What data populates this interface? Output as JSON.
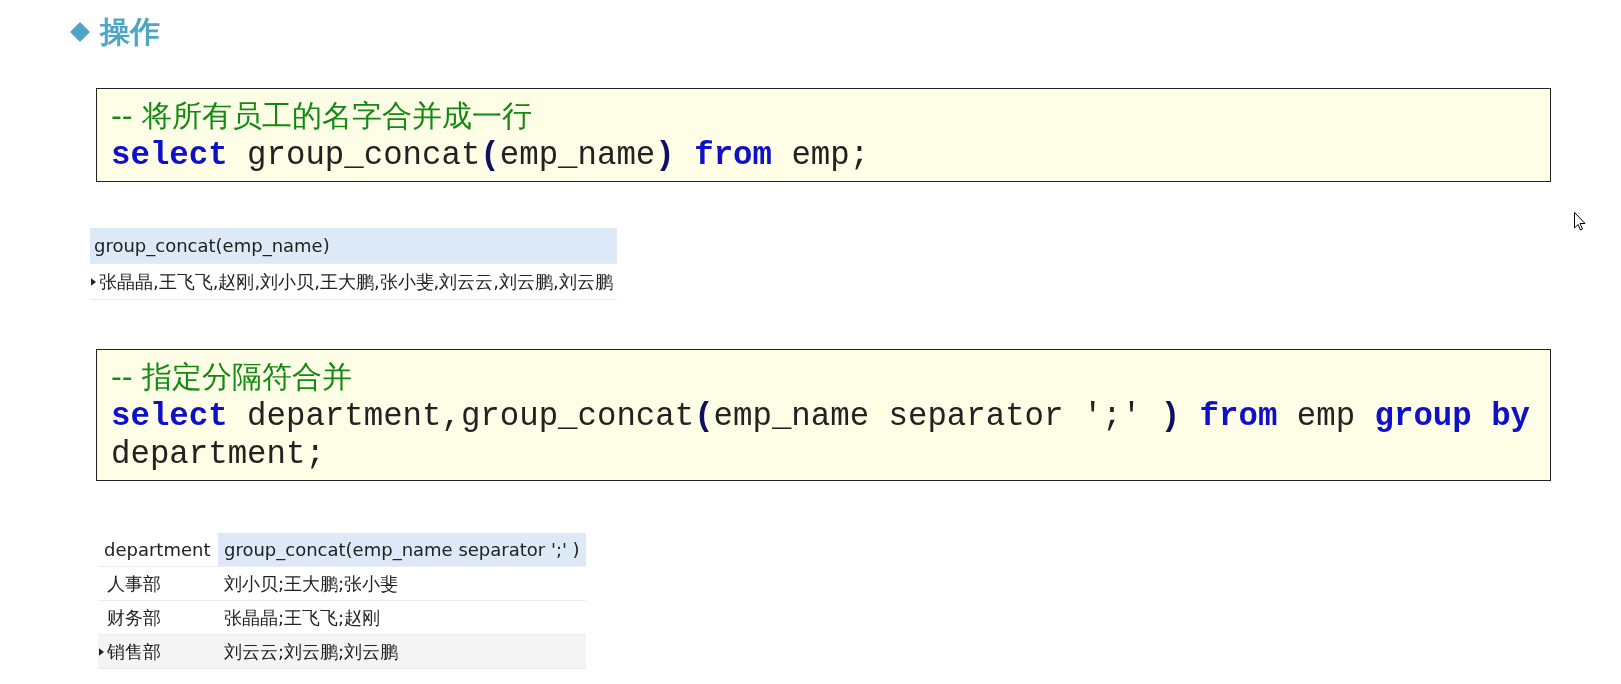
{
  "heading": {
    "title": "操作"
  },
  "sections": [
    {
      "code": [
        [
          {
            "kind": "comment",
            "text": "-- 将所有员工的名字合并成一行"
          }
        ],
        [
          {
            "kind": "keyword",
            "text": "select"
          },
          {
            "kind": "plain",
            "text": " group_concat"
          },
          {
            "kind": "punct",
            "text": "("
          },
          {
            "kind": "plain",
            "text": "emp_name"
          },
          {
            "kind": "punct",
            "text": ")"
          },
          {
            "kind": "keyword",
            "text": " from"
          },
          {
            "kind": "plain",
            "text": " emp;"
          }
        ]
      ],
      "result": {
        "columns": [
          "group_concat(emp_name)"
        ],
        "rows": [
          {
            "selected": true,
            "cells": [
              "张晶晶,王飞飞,赵刚,刘小贝,王大鹏,张小斐,刘云云,刘云鹏,刘云鹏"
            ]
          }
        ]
      }
    },
    {
      "code": [
        [
          {
            "kind": "comment",
            "text": "-- 指定分隔符合并"
          }
        ],
        [
          {
            "kind": "keyword",
            "text": "select"
          },
          {
            "kind": "plain",
            "text": " department,group_concat"
          },
          {
            "kind": "punct",
            "text": "("
          },
          {
            "kind": "plain",
            "text": "emp_name separator ';' "
          },
          {
            "kind": "punct",
            "text": ")"
          },
          {
            "kind": "keyword",
            "text": " from"
          },
          {
            "kind": "plain",
            "text": " emp "
          },
          {
            "kind": "keyword",
            "text": "group by"
          }
        ],
        [
          {
            "kind": "plain",
            "text": "department;"
          }
        ]
      ],
      "result": {
        "columns": [
          "department",
          "group_concat(emp_name separator ';' )"
        ],
        "rows": [
          {
            "selected": false,
            "cells": [
              "人事部",
              "刘小贝;王大鹏;张小斐"
            ]
          },
          {
            "selected": false,
            "cells": [
              "财务部",
              "张晶晶;王飞飞;赵刚"
            ]
          },
          {
            "selected": true,
            "cells": [
              "销售部",
              "刘云云;刘云鹏;刘云鹏"
            ]
          }
        ]
      }
    }
  ]
}
